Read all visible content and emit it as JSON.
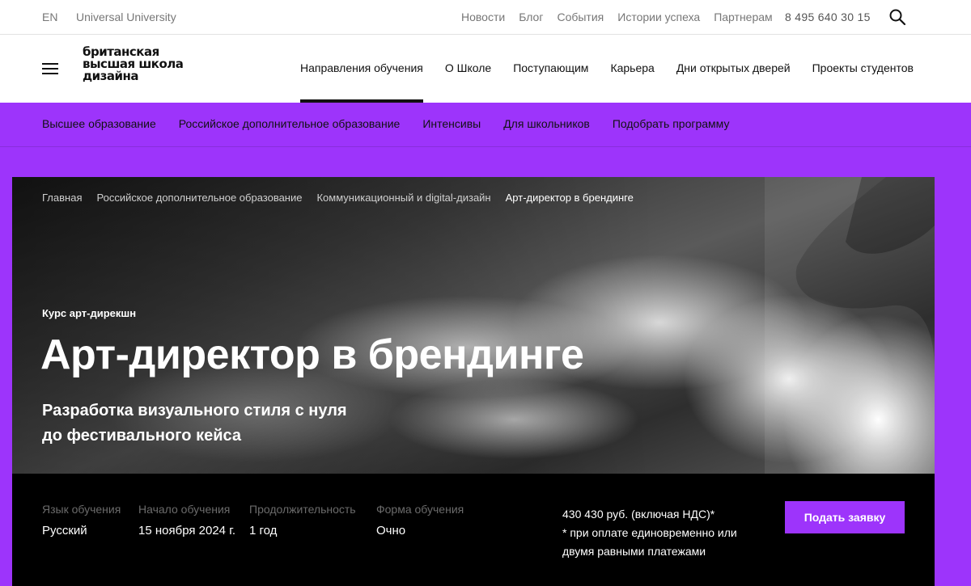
{
  "topbar": {
    "lang": "EN",
    "university": "Universal University",
    "links": [
      "Новости",
      "Блог",
      "События",
      "Истории успеха",
      "Партнерам"
    ],
    "phone": "8 495 640 30 15"
  },
  "logo": {
    "lines": [
      "британская",
      "высшая школа",
      "дизайна"
    ]
  },
  "mainnav": {
    "items": [
      "Направления обучения",
      "О Школе",
      "Поступающим",
      "Карьера",
      "Дни открытых дверей",
      "Проекты студентов"
    ],
    "active_index": 0
  },
  "subnav": {
    "items": [
      "Высшее образование",
      "Российское дополнительное образование",
      "Интенсивы",
      "Для школьников",
      "Подобрать программу"
    ]
  },
  "breadcrumbs": [
    "Главная",
    "Российское дополнительное образование",
    "Коммуникационный и digital-дизайн",
    "Арт-директор в брендинге"
  ],
  "hero": {
    "kicker": "Курс арт-дирекшн",
    "title": "Арт-директор в брендинге",
    "subtitle_line1": "Разработка визуального стиля с нуля",
    "subtitle_line2": "до фестивального кейса"
  },
  "facts": [
    {
      "label": "Язык обучения",
      "value": "Русский"
    },
    {
      "label": "Начало обучения",
      "value": "15 ноября 2024 г."
    },
    {
      "label": "Продолжительность",
      "value": "1 год"
    },
    {
      "label": "Форма обучения",
      "value": "Очно"
    }
  ],
  "price": {
    "line1": "430 430 руб. (включая НДС)*",
    "line2": "* при оплате единовременно или",
    "line3": "двумя равными платежами"
  },
  "apply_button": "Подать заявку",
  "colors": {
    "accent": "#9d34fb",
    "dark": "#000000",
    "text": "#111111",
    "muted": "#777777"
  },
  "icons": {
    "search": "search-icon",
    "menu": "menu-icon"
  }
}
